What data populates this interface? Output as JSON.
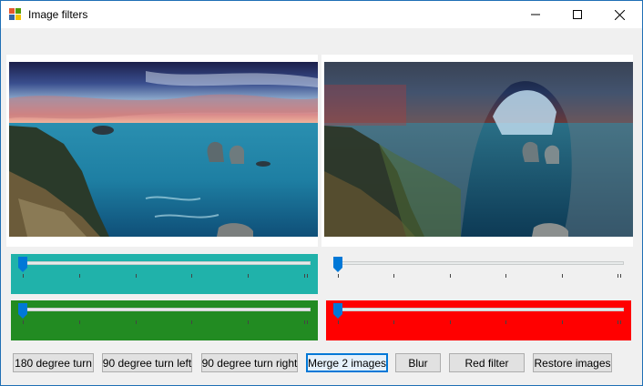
{
  "window": {
    "title": "Image filters"
  },
  "sliders": [
    {
      "panel_color": "#20b2aa",
      "value": 0
    },
    {
      "panel_color": "#f0f0f0",
      "value": 0
    },
    {
      "panel_color": "#228b22",
      "value": 0
    },
    {
      "panel_color": "#ff0000",
      "value": 0
    }
  ],
  "buttons": [
    {
      "label": "180 degree turn",
      "name": "rotate-180-button"
    },
    {
      "label": "90 degree turn left",
      "name": "rotate-90-left-button"
    },
    {
      "label": "90 degree turn right",
      "name": "rotate-90-right-button"
    },
    {
      "label": "Merge 2 images",
      "name": "merge-images-button",
      "focused": true
    },
    {
      "label": "Blur",
      "name": "blur-button"
    },
    {
      "label": "Red filter",
      "name": "red-filter-button"
    },
    {
      "label": "Restore images",
      "name": "restore-images-button"
    }
  ],
  "colors": {
    "accent": "#0078d7",
    "window_border": "#1f6fb5"
  }
}
